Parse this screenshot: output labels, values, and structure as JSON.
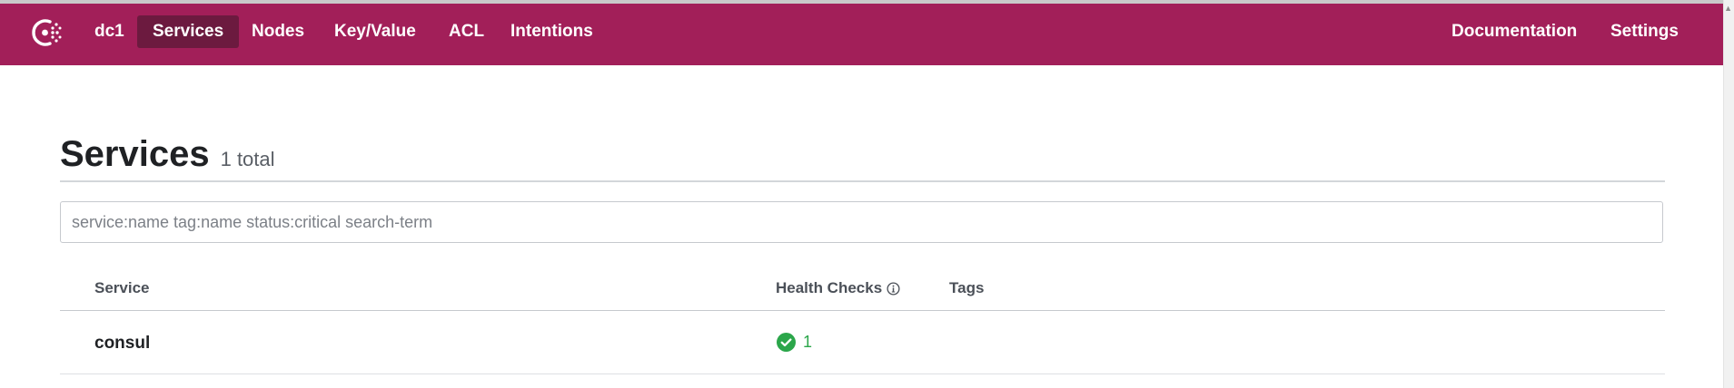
{
  "nav": {
    "logo_icon": "consul-logo-icon",
    "datacenter": "dc1",
    "items": [
      {
        "label": "Services",
        "active": true
      },
      {
        "label": "Nodes",
        "active": false
      },
      {
        "label": "Key/Value",
        "active": false
      },
      {
        "label": "ACL",
        "active": false
      },
      {
        "label": "Intentions",
        "active": false
      }
    ],
    "right_items": [
      {
        "label": "Documentation"
      },
      {
        "label": "Settings"
      }
    ]
  },
  "page": {
    "title": "Services",
    "count": "1 total"
  },
  "search": {
    "placeholder": "service:name tag:name status:critical search-term",
    "value": ""
  },
  "table": {
    "columns": [
      "Service",
      "Health Checks",
      "Tags"
    ],
    "rows": [
      {
        "service": "consul",
        "health_passing": "1",
        "tags": ""
      }
    ]
  },
  "colors": {
    "brand": "#a21f59",
    "brand_active": "#6c1a3f",
    "passing": "#2ba64a"
  }
}
